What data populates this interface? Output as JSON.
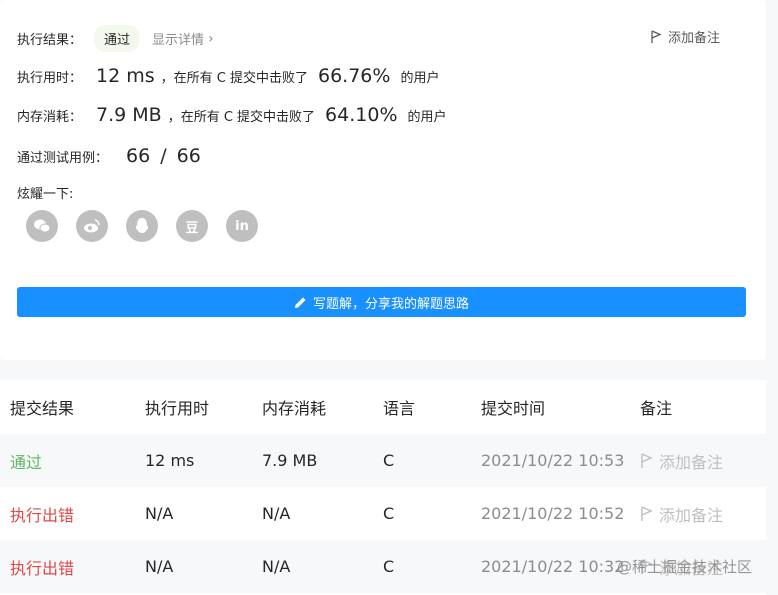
{
  "result": {
    "label": "执行结果：",
    "status": "通过",
    "detail_link": "显示详情",
    "add_note": "添加备注"
  },
  "runtime": {
    "label": "执行用时：",
    "value": "12 ms",
    "mid_text": "，在所有 C 提交中击败了",
    "percent": "66.76%",
    "suffix": "的用户"
  },
  "memory": {
    "label": "内存消耗：",
    "value": "7.9 MB",
    "mid_text": "，在所有 C 提交中击败了",
    "percent": "64.10%",
    "suffix": "的用户"
  },
  "testcases": {
    "label": "通过测试用例：",
    "passed": "66",
    "sep": "/",
    "total": "66"
  },
  "share": {
    "label": "炫耀一下:",
    "icons": [
      "wechat-icon",
      "weibo-icon",
      "qq-icon",
      "douban-icon",
      "linkedin-icon"
    ],
    "douban_glyph": "豆",
    "linkedin_glyph": "in"
  },
  "solution_button": "写题解，分享我的解题思路",
  "table": {
    "headers": [
      "提交结果",
      "执行用时",
      "内存消耗",
      "语言",
      "提交时间",
      "备注"
    ],
    "rows": [
      {
        "result": "通过",
        "runtime": "12 ms",
        "memory": "7.9 MB",
        "lang": "C",
        "time": "2021/10/22 10:53",
        "note": "添加备注"
      },
      {
        "result": "执行出错",
        "runtime": "N/A",
        "memory": "N/A",
        "lang": "C",
        "time": "2021/10/22 10:52",
        "note": "添加备注"
      },
      {
        "result": "执行出错",
        "runtime": "N/A",
        "memory": "N/A",
        "lang": "C",
        "time": "2021/10/22 10:32",
        "note": "添加备注"
      }
    ]
  },
  "watermark": "@稀土掘金技术社区",
  "colors": {
    "accent": "#1890ff",
    "success": "#5cb85c",
    "error": "#e04848"
  }
}
